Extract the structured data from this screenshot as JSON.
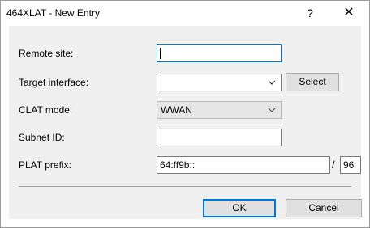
{
  "window": {
    "title": "464XLAT - New Entry",
    "help_label": "?",
    "close_label": "✕"
  },
  "form": {
    "remote_site": {
      "label": "Remote site:",
      "value": ""
    },
    "target_interface": {
      "label": "Target interface:",
      "value": "",
      "select_label": "Select"
    },
    "clat_mode": {
      "label": "CLAT mode:",
      "value": "WWAN"
    },
    "subnet_id": {
      "label": "Subnet ID:",
      "value": ""
    },
    "plat_prefix": {
      "label": "PLAT prefix:",
      "value": "64:ff9b::",
      "separator": "/",
      "length": "96"
    }
  },
  "buttons": {
    "ok": "OK",
    "cancel": "Cancel"
  },
  "colors": {
    "focus_border": "#0078d7",
    "dialog_background": "#f0f0f0"
  },
  "icons": {
    "combo_arrow": "chevron-down-icon",
    "close": "close-icon",
    "help": "help-icon"
  }
}
